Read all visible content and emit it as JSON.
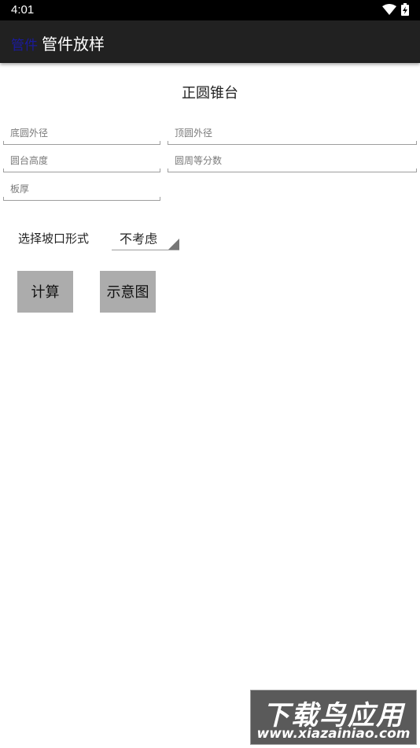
{
  "status_bar": {
    "time": "4:01"
  },
  "app_bar": {
    "menu_label": "管件",
    "title": "管件放样"
  },
  "form": {
    "heading": "正圆锥台",
    "fields": [
      {
        "placeholder": "底圆外径",
        "value": ""
      },
      {
        "placeholder": "顶圆外径",
        "value": ""
      },
      {
        "placeholder": "圆台高度",
        "value": ""
      },
      {
        "placeholder": "圆周等分数",
        "value": ""
      },
      {
        "placeholder": "板厚",
        "value": ""
      }
    ],
    "bevel_label": "选择坡口形式",
    "bevel_selected": "不考虑"
  },
  "buttons": {
    "calculate": "计算",
    "diagram": "示意图"
  },
  "watermark": {
    "top": "下载鸟应用",
    "bottom": "www.xiazainiao.com"
  }
}
